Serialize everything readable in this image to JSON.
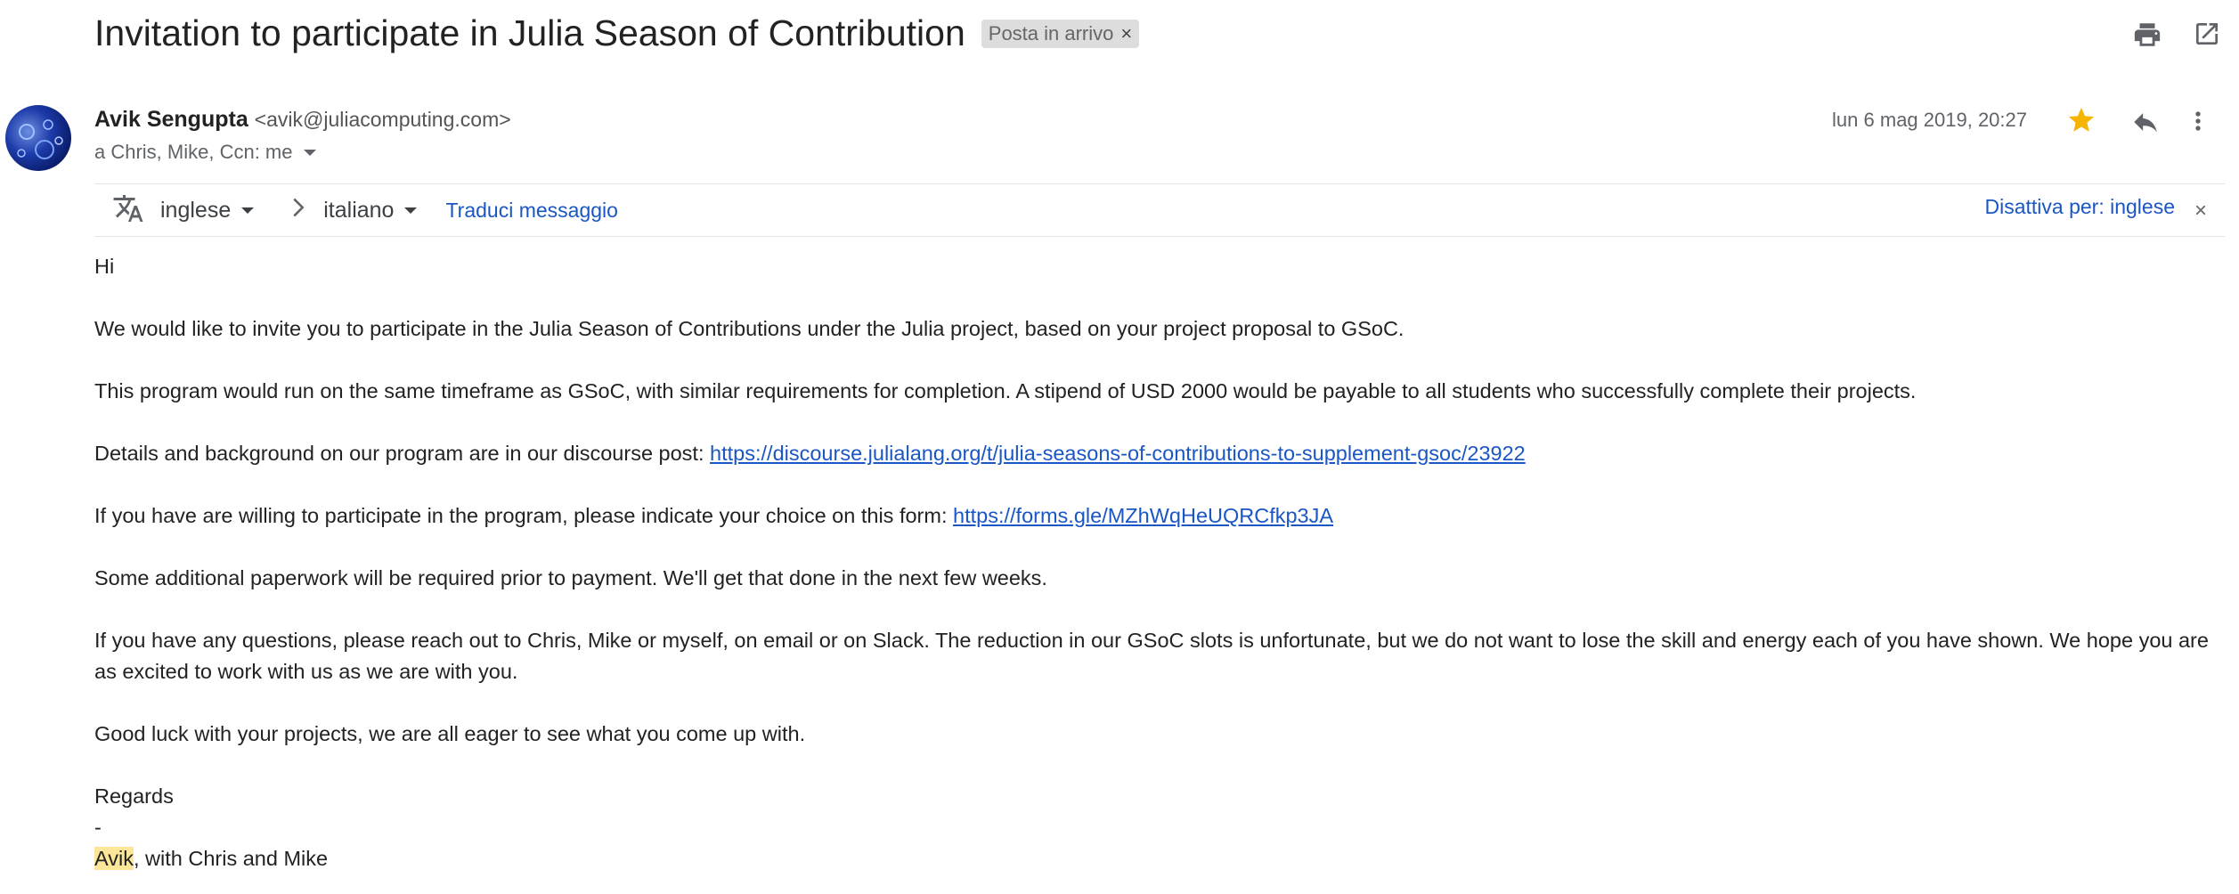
{
  "subject": "Invitation to participate in Julia Season of Contribution",
  "label": {
    "text": "Posta in arrivo",
    "remove": "×"
  },
  "sender": {
    "name": "Avik Sengupta",
    "email": "<avik@juliacomputing.com>"
  },
  "recipients": "a Chris, Mike, Ccn: me",
  "date": "lun 6 mag 2019, 20:27",
  "translate": {
    "from": "inglese",
    "to": "italiano",
    "action": "Traduci messaggio",
    "disable": "Disattiva per: inglese",
    "close": "×"
  },
  "body": {
    "greeting": "Hi",
    "p1": "We would like to invite you to participate in the Julia Season of Contributions under the Julia project, based on your project proposal to GSoC.",
    "p2": "This program would run on the same timeframe as GSoC, with similar requirements for completion. A stipend of USD 2000 would be payable to all students who successfully complete their projects.",
    "p3_text": "Details and background on our program are in our discourse post: ",
    "p3_link": "https://discourse.julialang.org/t/julia-seasons-of-contributions-to-supplement-gsoc/23922",
    "p4_text": "If you have are willing to participate in the program, please indicate your choice on this form: ",
    "p4_link": "https://forms.gle/MZhWqHeUQRCfkp3JA",
    "p5": "Some additional paperwork will be required prior to payment. We'll get that done in the next few weeks.",
    "p6": "If you have any questions, please reach out to Chris, Mike or myself, on email or on Slack. The reduction in our GSoC slots is unfortunate, but we do not want to lose the skill and energy each of you have shown. We hope you are as excited to work with us as we are with you.",
    "p7": "Good luck with your projects, we are all eager to see what you come up with.",
    "regards": "Regards",
    "dash": "-",
    "sig_name": "Avik",
    "sig_rest": ", with Chris and Mike"
  },
  "colors": {
    "link": "#1a56c4",
    "star": "#f4b400",
    "highlight": "#fce699"
  },
  "icons": [
    "print-icon",
    "open-in-new-window-icon",
    "star-icon",
    "reply-icon",
    "more-vert-icon",
    "translate-icon",
    "chevron-right-icon",
    "close-icon"
  ]
}
